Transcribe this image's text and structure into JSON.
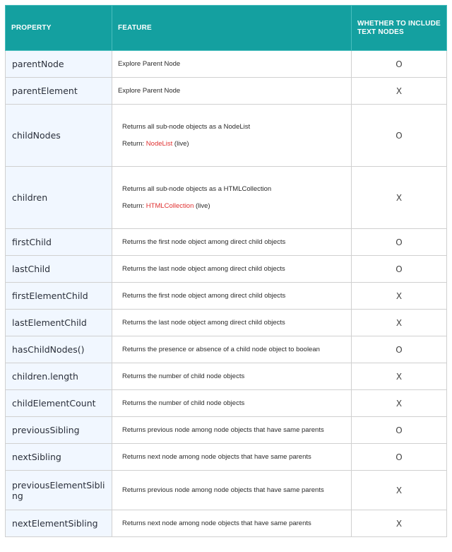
{
  "headers": {
    "property": "PROPERTY",
    "feature": "FEATURE",
    "include": "WHETHER TO INCLUDE TEXT NODES"
  },
  "rows": [
    {
      "property": "parentNode",
      "feature": "Explore Parent Node",
      "include": "O"
    },
    {
      "property": "parentElement",
      "feature": "Explore Parent Node",
      "include": "X"
    },
    {
      "property": "childNodes",
      "feature": "Returns all sub-node objects as a NodeList",
      "return_label": "Return: ",
      "return_type": "NodeList",
      "return_suffix": " (live)",
      "include": "O"
    },
    {
      "property": "children",
      "feature": "Returns all sub-node objects as a HTMLCollection",
      "return_label": "Return: ",
      "return_type": "HTMLCollection",
      "return_suffix": " (live)",
      "include": "X"
    },
    {
      "property": "firstChild",
      "feature": "Returns the first node object among direct child objects",
      "include": "O"
    },
    {
      "property": "lastChild",
      "feature": "Returns the last node object among direct child objects",
      "include": "O"
    },
    {
      "property": "firstElementChild",
      "feature": "Returns the first node object among direct child objects",
      "include": "X"
    },
    {
      "property": "lastElementChild",
      "feature": "Returns the last node object among direct child objects",
      "include": "X"
    },
    {
      "property": "hasChildNodes()",
      "feature": "Returns the presence or absence of a child node object to boolean",
      "include": "O"
    },
    {
      "property": "children.length",
      "feature": "Returns the number of child node objects",
      "include": "X"
    },
    {
      "property": "childElementCount",
      "feature": "Returns the number of child node objects",
      "include": "X"
    },
    {
      "property": "previousSibling",
      "feature": "Returns previous node among node objects that have same parents",
      "include": "O"
    },
    {
      "property": "nextSibling",
      "feature": "Returns next node among node objects that have same parents",
      "include": "O"
    },
    {
      "property": "previousElementSibling",
      "feature": "Returns previous node among node objects that have same parents",
      "include": "X"
    },
    {
      "property": "nextElementSibling",
      "feature": "Returns next node among node objects that have same parents",
      "include": "X"
    }
  ],
  "colors": {
    "header_bg": "#14a0a0",
    "property_bg": "#f1f7ff",
    "highlight": "#e03030"
  }
}
